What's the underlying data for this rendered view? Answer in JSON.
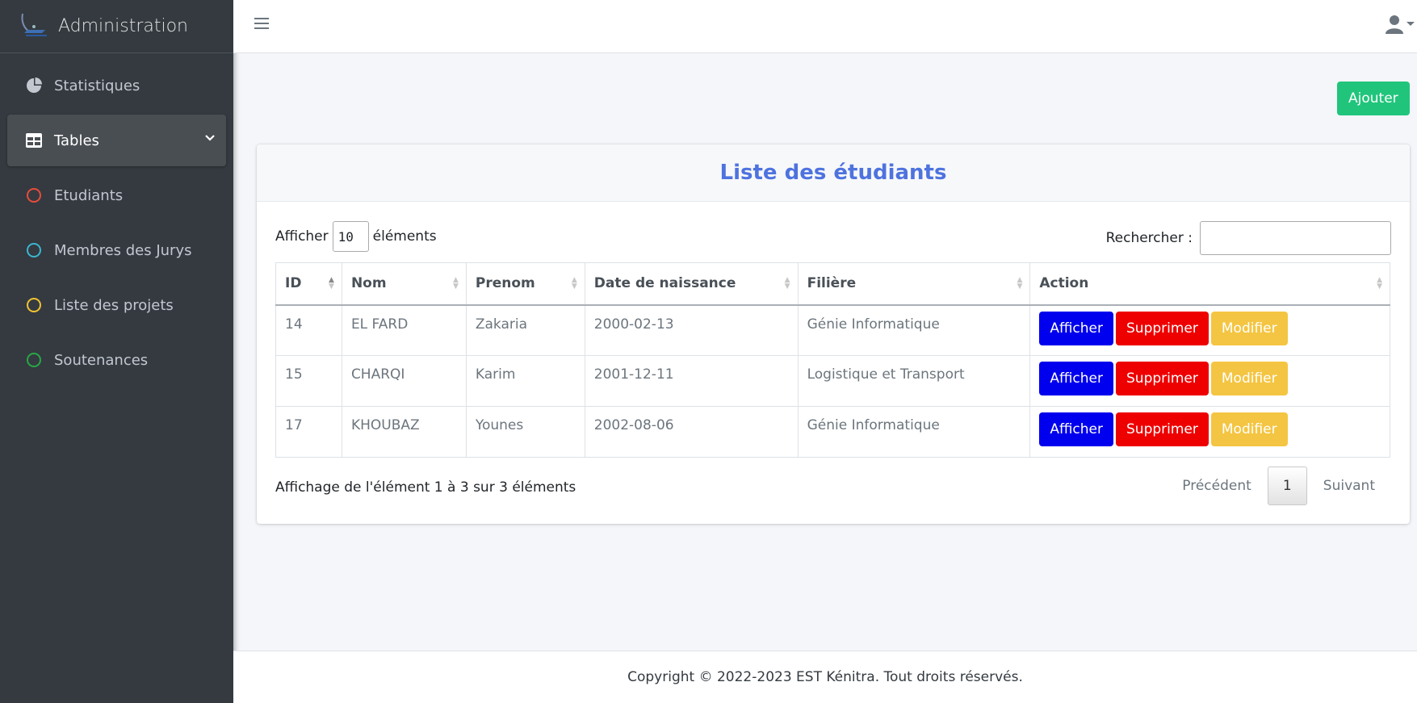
{
  "brand": {
    "title": "Administration"
  },
  "sidebar": {
    "items": [
      {
        "label": "Statistiques",
        "icon": "pie-chart-icon"
      },
      {
        "label": "Tables",
        "icon": "table-icon"
      },
      {
        "label": "Etudiants",
        "icon": "circle-icon",
        "color": "#e74c3c"
      },
      {
        "label": "Membres des Jurys",
        "icon": "circle-icon",
        "color": "#3ab6d1"
      },
      {
        "label": "Liste des projets",
        "icon": "circle-icon",
        "color": "#f1c232"
      },
      {
        "label": "Soutenances",
        "icon": "circle-icon",
        "color": "#28a745"
      }
    ]
  },
  "header": {
    "menu_icon": "hamburger-icon",
    "user_icon": "user-icon"
  },
  "toolbar": {
    "add_label": "Ajouter"
  },
  "card": {
    "title": "Liste des étudiants"
  },
  "table_controls": {
    "length_prefix": "Afficher",
    "length_value": "10",
    "length_suffix": "éléments",
    "search_label": "Rechercher :",
    "search_value": ""
  },
  "table": {
    "columns": [
      "ID",
      "Nom",
      "Prenom",
      "Date de naissance",
      "Filière",
      "Action"
    ],
    "rows": [
      [
        "14",
        "EL FARD",
        "Zakaria",
        "2000-02-13",
        "Génie Informatique"
      ],
      [
        "15",
        "CHARQI",
        "Karim",
        "2001-12-11",
        "Logistique et Transport"
      ],
      [
        "17",
        "KHOUBAZ",
        "Younes",
        "2002-08-06",
        "Génie Informatique"
      ]
    ],
    "actions": {
      "show": "Afficher",
      "delete": "Supprimer",
      "edit": "Modifier"
    }
  },
  "pagination": {
    "info": "Affichage de l'élément 1 à 3 sur 3 éléments",
    "previous": "Précédent",
    "current": "1",
    "next": "Suivant"
  },
  "colors": {
    "add_button": "#20c57b",
    "title": "#4e73df",
    "show": "#0000ee",
    "delete": "#ee0000",
    "edit": "#f4c542"
  },
  "footer": {
    "text": "Copyright © 2022-2023 EST Kénitra. Tout droits réservés."
  }
}
